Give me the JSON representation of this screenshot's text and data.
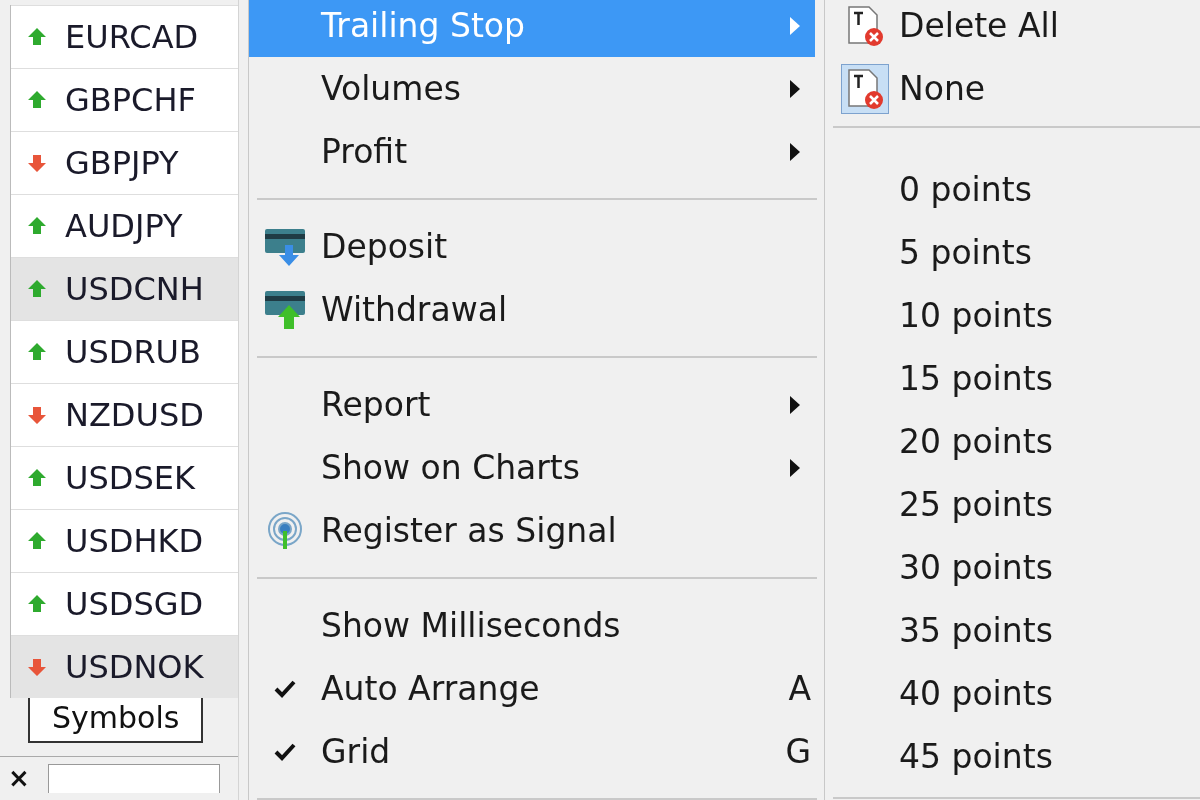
{
  "symbols": [
    {
      "name": "EURCAD",
      "kind": "up",
      "highlighted": false
    },
    {
      "name": "GBPCHF",
      "kind": "up",
      "highlighted": false
    },
    {
      "name": "GBPJPY",
      "kind": "down",
      "highlighted": false
    },
    {
      "name": "AUDJPY",
      "kind": "up",
      "highlighted": false
    },
    {
      "name": "USDCNH",
      "kind": "up",
      "highlighted": true
    },
    {
      "name": "USDRUB",
      "kind": "up",
      "highlighted": false
    },
    {
      "name": "NZDUSD",
      "kind": "down",
      "highlighted": false
    },
    {
      "name": "USDSEK",
      "kind": "up",
      "highlighted": false
    },
    {
      "name": "USDHKD",
      "kind": "up",
      "highlighted": false
    },
    {
      "name": "USDSGD",
      "kind": "up",
      "highlighted": false
    },
    {
      "name": "USDNOK",
      "kind": "down",
      "highlighted": true
    }
  ],
  "symbols_tab": {
    "label": "Symbols",
    "selected": true
  },
  "close_button": "×",
  "menu": [
    {
      "kind": "submenu",
      "label": "Trailing Stop",
      "selected": true
    },
    {
      "kind": "submenu",
      "label": "Volumes",
      "selected": false
    },
    {
      "kind": "submenu",
      "label": "Profit",
      "selected": false
    },
    {
      "kind": "separator"
    },
    {
      "kind": "deposit",
      "label": "Deposit",
      "selected": false
    },
    {
      "kind": "withdrawal",
      "label": "Withdrawal",
      "selected": false
    },
    {
      "kind": "separator"
    },
    {
      "kind": "submenu",
      "label": "Report",
      "selected": false
    },
    {
      "kind": "submenu",
      "label": "Show on Charts",
      "selected": false
    },
    {
      "kind": "signal",
      "label": "Register as Signal",
      "selected": false
    },
    {
      "kind": "separator"
    },
    {
      "kind": "checkable",
      "label": "Show Milliseconds",
      "selected": false,
      "checked": false
    },
    {
      "kind": "checkable",
      "label": "Auto Arrange",
      "selected": false,
      "checked": true,
      "shortcut": "A"
    },
    {
      "kind": "checkable",
      "label": "Grid",
      "selected": false,
      "checked": true,
      "shortcut": "G"
    },
    {
      "kind": "separator"
    }
  ],
  "submenu": [
    {
      "kind": "delete",
      "label": "Delete All",
      "selected": false
    },
    {
      "kind": "delete",
      "label": "None",
      "selected": true
    },
    {
      "kind": "separator"
    },
    {
      "kind": "points",
      "label": "0 points"
    },
    {
      "kind": "points",
      "label": "5 points"
    },
    {
      "kind": "points",
      "label": "10 points"
    },
    {
      "kind": "points",
      "label": "15 points"
    },
    {
      "kind": "points",
      "label": "20 points"
    },
    {
      "kind": "points",
      "label": "25 points"
    },
    {
      "kind": "points",
      "label": "30 points"
    },
    {
      "kind": "points",
      "label": "35 points"
    },
    {
      "kind": "points",
      "label": "40 points"
    },
    {
      "kind": "points",
      "label": "45 points"
    },
    {
      "kind": "separator"
    }
  ]
}
